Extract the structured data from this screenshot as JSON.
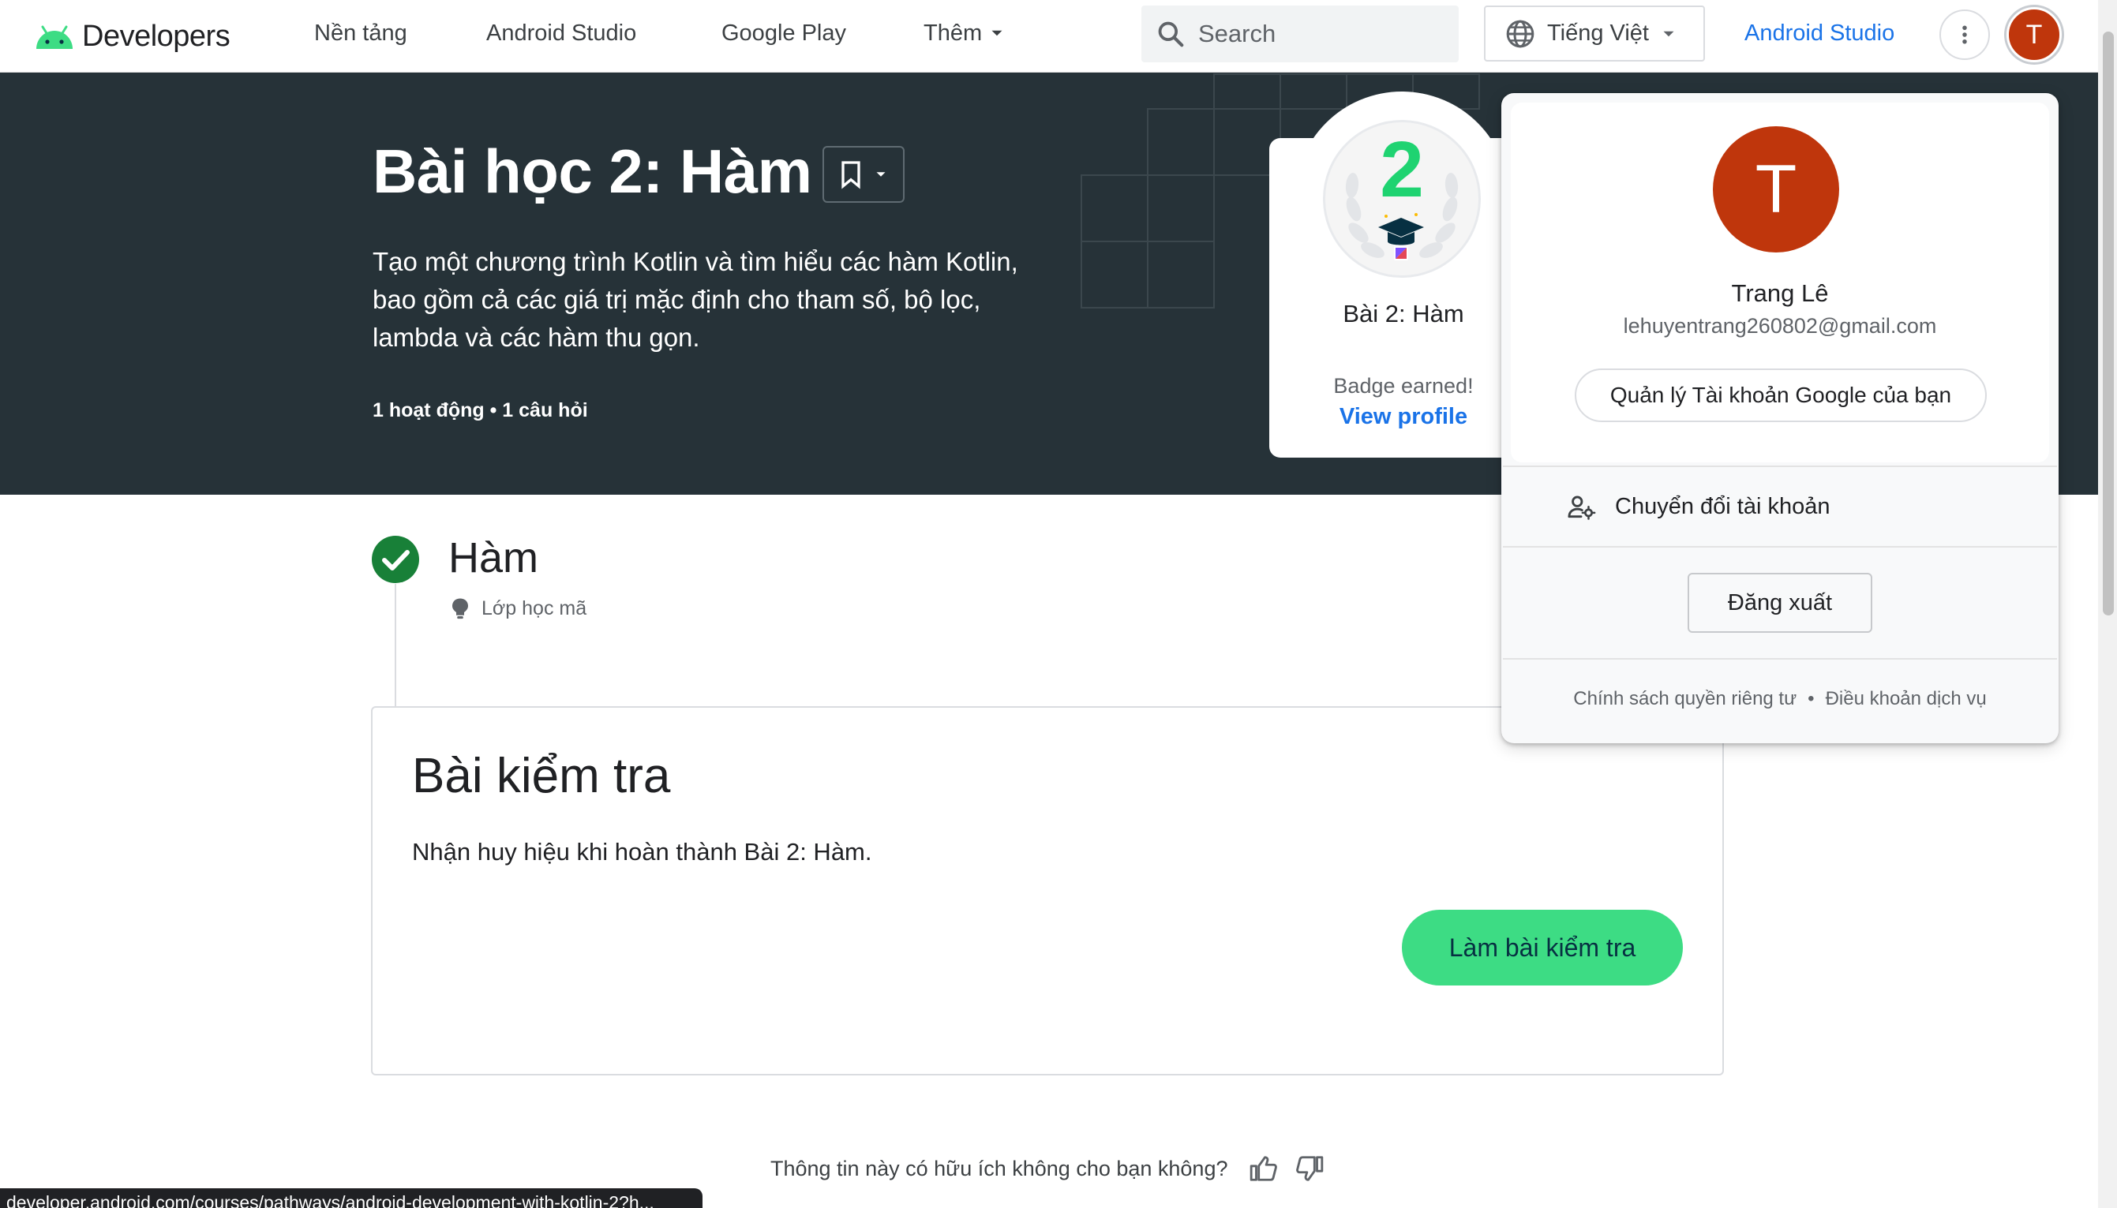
{
  "nav": {
    "logo_text": "Developers",
    "links": [
      "Nền tảng",
      "Android Studio",
      "Google Play"
    ],
    "more_label": "Thêm",
    "search_placeholder": "Search",
    "language": "Tiếng Việt",
    "studio_link": "Android Studio",
    "avatar_initial": "T"
  },
  "hero": {
    "title": "Bài học 2: Hàm",
    "description": "Tạo một chương trình Kotlin và tìm hiểu các hàm Kotlin, bao gồm cả các giá trị mặc định cho tham số, bộ lọc, lambda và các hàm thu gọn.",
    "meta": "1 hoạt động • 1 câu hỏi"
  },
  "badge": {
    "number": "2",
    "name": "Bài 2: Hàm",
    "earned": "Badge earned!",
    "view_profile": "View profile"
  },
  "section": {
    "title": "Hàm",
    "subtitle": "Lớp học mã"
  },
  "quiz": {
    "title": "Bài kiểm tra",
    "description": "Nhận huy hiệu khi hoàn thành Bài 2: Hàm.",
    "button": "Làm bài kiểm tra"
  },
  "feedback": {
    "question": "Thông tin này có hữu ích không cho bạn không?"
  },
  "status_url": "developer.android.com/courses/pathways/android-development-with-kotlin-2?h...",
  "account": {
    "initial": "T",
    "name": "Trang Lê",
    "email": "lehuyentrang260802@gmail.com",
    "manage": "Quản lý Tài khoản Google của bạn",
    "switch": "Chuyển đổi tài khoản",
    "logout": "Đăng xuất",
    "privacy": "Chính sách quyền riêng tư",
    "terms": "Điều khoản dịch vụ"
  },
  "colors": {
    "hero_bg": "#263238",
    "accent_green": "#3ddc84",
    "link_blue": "#1a73e8",
    "avatar": "#bf360c",
    "check_green": "#188038"
  }
}
